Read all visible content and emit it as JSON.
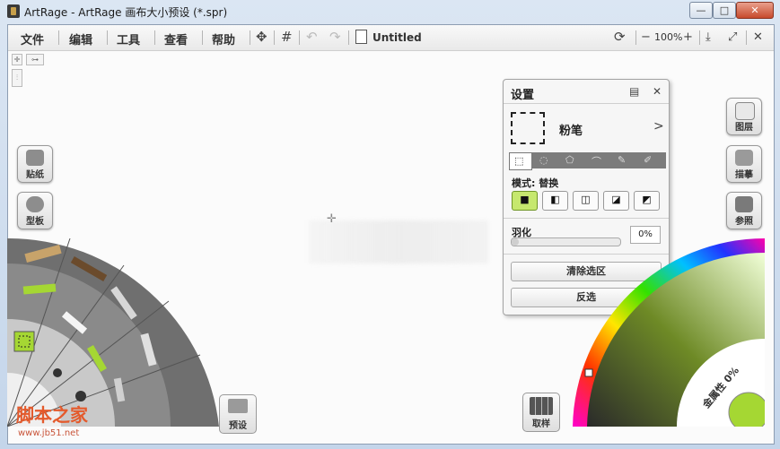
{
  "window": {
    "title": "ArtRage - ArtRage 画布大小预设 (*.spr)",
    "min_glyph": "—",
    "max_glyph": "□",
    "close_glyph": "✕"
  },
  "menu": {
    "items": [
      "文件",
      "编辑",
      "工具",
      "查看",
      "帮助"
    ],
    "doc_title": "Untitled",
    "zoom": "100%",
    "zoom_minus": "−",
    "zoom_plus": "+",
    "transform_glyph": "✥",
    "grid_glyph": "#",
    "undo_glyph": "↶",
    "redo_glyph": "↷",
    "refresh_glyph": "⟳",
    "download_glyph": "⤓",
    "fullscreen_glyph": "⤢",
    "close_glyph": "✕"
  },
  "left_buttons": {
    "sticker": "贴纸",
    "stencil": "型板"
  },
  "right_buttons": {
    "layers": "图层",
    "tracing": "描摹",
    "reference": "参照"
  },
  "bottom_buttons": {
    "preset": "预设",
    "sample": "取样"
  },
  "settings_panel": {
    "title": "设置",
    "close_glyph": "✕",
    "tool_name": "粉笔",
    "chevron": ">",
    "mode_label": "模式: 替换",
    "mode_glyphs": [
      "■",
      "◧",
      "◫",
      "◪",
      "◩"
    ],
    "tab_glyphs": [
      "⬚",
      "◌",
      "⬠",
      "⌒",
      "✎",
      "✐"
    ],
    "feather_label": "羽化",
    "feather_value": "0%",
    "feather_level": 0,
    "clear_selection": "清除选区",
    "invert": "反选"
  },
  "color_wheel": {
    "metallic_label": "金属性 0%",
    "selected_color": "#a5d733"
  },
  "watermark": {
    "text": "脚本之家",
    "url": "www.jb51.net"
  },
  "accent": "#a5d733"
}
